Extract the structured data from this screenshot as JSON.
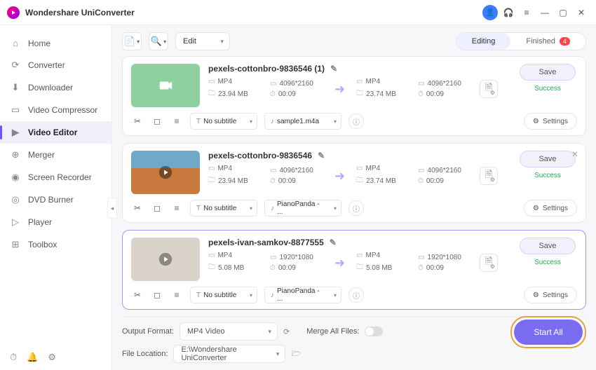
{
  "app": {
    "title": "Wondershare UniConverter"
  },
  "sidebar": {
    "items": [
      {
        "label": "Home",
        "icon": "⌂"
      },
      {
        "label": "Converter",
        "icon": "⟳"
      },
      {
        "label": "Downloader",
        "icon": "⬇"
      },
      {
        "label": "Video Compressor",
        "icon": "▭"
      },
      {
        "label": "Video Editor",
        "icon": "▶"
      },
      {
        "label": "Merger",
        "icon": "⊕"
      },
      {
        "label": "Screen Recorder",
        "icon": "◉"
      },
      {
        "label": "DVD Burner",
        "icon": "◎"
      },
      {
        "label": "Player",
        "icon": "▷"
      },
      {
        "label": "Toolbox",
        "icon": "⊞"
      }
    ]
  },
  "toolbar": {
    "edit_label": "Edit",
    "tab_editing": "Editing",
    "tab_finished": "Finished",
    "finished_count": "4"
  },
  "items": [
    {
      "filename": "pexels-cottonbro-9836546 (1)",
      "in": {
        "format": "MP4",
        "res": "4096*2160",
        "size": "23.94 MB",
        "dur": "00:09"
      },
      "out": {
        "format": "MP4",
        "res": "4096*2160",
        "size": "23.74 MB",
        "dur": "00:09"
      },
      "subtitle": "No subtitle",
      "audio": "sample1.m4a",
      "save": "Save",
      "status": "Success",
      "settings": "Settings"
    },
    {
      "filename": "pexels-cottonbro-9836546",
      "in": {
        "format": "MP4",
        "res": "4096*2160",
        "size": "23.94 MB",
        "dur": "00:09"
      },
      "out": {
        "format": "MP4",
        "res": "4096*2160",
        "size": "23.74 MB",
        "dur": "00:09"
      },
      "subtitle": "No subtitle",
      "audio": "PianoPanda - ...",
      "save": "Save",
      "status": "Success",
      "settings": "Settings"
    },
    {
      "filename": "pexels-ivan-samkov-8877555",
      "in": {
        "format": "MP4",
        "res": "1920*1080",
        "size": "5.08 MB",
        "dur": "00:09"
      },
      "out": {
        "format": "MP4",
        "res": "1920*1080",
        "size": "5.08 MB",
        "dur": "00:09"
      },
      "subtitle": "No subtitle",
      "audio": "PianoPanda - ...",
      "save": "Save",
      "status": "Success",
      "settings": "Settings"
    }
  ],
  "footer": {
    "output_label": "Output Format:",
    "output_value": "MP4 Video",
    "merge_label": "Merge All Files:",
    "loc_label": "File Location:",
    "loc_value": "E:\\Wondershare UniConverter",
    "start_all": "Start All"
  }
}
